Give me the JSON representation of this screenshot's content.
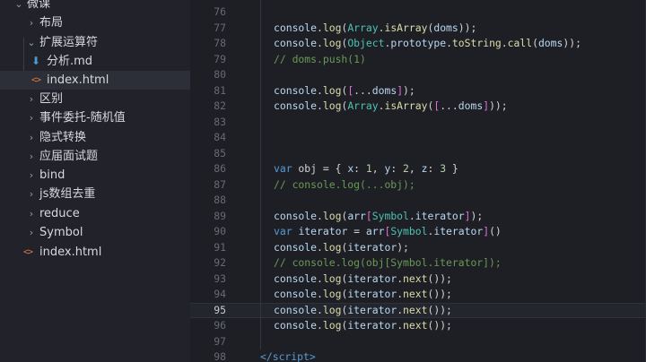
{
  "explorer": {
    "items": [
      {
        "label": "微课",
        "chevron": "⌄",
        "icon": "",
        "active": false
      },
      {
        "label": "布局",
        "chevron": "›",
        "icon": "",
        "active": false
      },
      {
        "label": "扩展运算符",
        "chevron": "⌄",
        "icon": "",
        "active": false
      },
      {
        "label": "分析.md",
        "chevron": "",
        "icon": "markdown-icon",
        "active": false
      },
      {
        "label": "index.html",
        "chevron": "",
        "icon": "html-icon",
        "active": true
      },
      {
        "label": "区别",
        "chevron": "›",
        "icon": "",
        "active": false
      },
      {
        "label": "事件委托-随机值",
        "chevron": "›",
        "icon": "",
        "active": false
      },
      {
        "label": "隐式转换",
        "chevron": "›",
        "icon": "",
        "active": false
      },
      {
        "label": "应届面试题",
        "chevron": "›",
        "icon": "",
        "active": false
      },
      {
        "label": "bind",
        "chevron": "›",
        "icon": "",
        "active": false
      },
      {
        "label": "js数组去重",
        "chevron": "›",
        "icon": "",
        "active": false
      },
      {
        "label": "reduce",
        "chevron": "›",
        "icon": "",
        "active": false
      },
      {
        "label": "Symbol",
        "chevron": "›",
        "icon": "",
        "active": false
      },
      {
        "label": "index.html",
        "chevron": "",
        "icon": "html-icon",
        "active": false
      }
    ],
    "html_icon_glyph": "<>",
    "md_icon_glyph": "⬇"
  },
  "editor": {
    "current_line": "95",
    "lines": [
      {
        "num": "76",
        "tokens": []
      },
      {
        "num": "77",
        "tokens": [
          [
            "console",
            "id"
          ],
          [
            ".",
            "plain"
          ],
          [
            "log",
            "fn"
          ],
          [
            "(",
            "plain"
          ],
          [
            "Array",
            "type"
          ],
          [
            ".",
            "plain"
          ],
          [
            "isArray",
            "fn"
          ],
          [
            "(",
            "plain"
          ],
          [
            "doms",
            "id"
          ],
          [
            "));",
            "plain"
          ]
        ]
      },
      {
        "num": "78",
        "tokens": [
          [
            "console",
            "id"
          ],
          [
            ".",
            "plain"
          ],
          [
            "log",
            "fn"
          ],
          [
            "(",
            "plain"
          ],
          [
            "Object",
            "type"
          ],
          [
            ".",
            "plain"
          ],
          [
            "prototype",
            "id"
          ],
          [
            ".",
            "plain"
          ],
          [
            "toString",
            "fn"
          ],
          [
            ".",
            "plain"
          ],
          [
            "call",
            "fn"
          ],
          [
            "(",
            "plain"
          ],
          [
            "doms",
            "id"
          ],
          [
            "));",
            "plain"
          ]
        ]
      },
      {
        "num": "79",
        "tokens": [
          [
            "// doms.push(1)",
            "cmt"
          ]
        ]
      },
      {
        "num": "80",
        "tokens": []
      },
      {
        "num": "81",
        "tokens": [
          [
            "console",
            "id"
          ],
          [
            ".",
            "plain"
          ],
          [
            "log",
            "fn"
          ],
          [
            "(",
            "plain"
          ],
          [
            "[",
            "brk"
          ],
          [
            "...",
            "plain"
          ],
          [
            "doms",
            "id"
          ],
          [
            "]",
            "brk"
          ],
          [
            ");",
            "plain"
          ]
        ]
      },
      {
        "num": "82",
        "tokens": [
          [
            "console",
            "id"
          ],
          [
            ".",
            "plain"
          ],
          [
            "log",
            "fn"
          ],
          [
            "(",
            "plain"
          ],
          [
            "Array",
            "type"
          ],
          [
            ".",
            "plain"
          ],
          [
            "isArray",
            "fn"
          ],
          [
            "(",
            "plain"
          ],
          [
            "[",
            "brk"
          ],
          [
            "...",
            "plain"
          ],
          [
            "doms",
            "id"
          ],
          [
            "]",
            "brk"
          ],
          [
            "));",
            "plain"
          ]
        ]
      },
      {
        "num": "83",
        "tokens": []
      },
      {
        "num": "84",
        "tokens": []
      },
      {
        "num": "85",
        "tokens": []
      },
      {
        "num": "86",
        "tokens": [
          [
            "var",
            "kw"
          ],
          [
            " obj = { ",
            "plain"
          ],
          [
            "x",
            "id"
          ],
          [
            ": ",
            "plain"
          ],
          [
            "1",
            "num"
          ],
          [
            ", ",
            "plain"
          ],
          [
            "y",
            "id"
          ],
          [
            ": ",
            "plain"
          ],
          [
            "2",
            "num"
          ],
          [
            ", ",
            "plain"
          ],
          [
            "z",
            "id"
          ],
          [
            ": ",
            "plain"
          ],
          [
            "3",
            "num"
          ],
          [
            " }",
            "plain"
          ]
        ]
      },
      {
        "num": "87",
        "tokens": [
          [
            "// console.log(...obj);",
            "cmt"
          ]
        ]
      },
      {
        "num": "88",
        "tokens": []
      },
      {
        "num": "89",
        "tokens": [
          [
            "console",
            "id"
          ],
          [
            ".",
            "plain"
          ],
          [
            "log",
            "fn"
          ],
          [
            "(",
            "plain"
          ],
          [
            "arr",
            "id"
          ],
          [
            "[",
            "brk"
          ],
          [
            "Symbol",
            "type"
          ],
          [
            ".",
            "plain"
          ],
          [
            "iterator",
            "id"
          ],
          [
            "]",
            "brk"
          ],
          [
            ");",
            "plain"
          ]
        ]
      },
      {
        "num": "90",
        "tokens": [
          [
            "var",
            "kw"
          ],
          [
            " ",
            "plain"
          ],
          [
            "iterator",
            "id"
          ],
          [
            " = ",
            "plain"
          ],
          [
            "arr",
            "id"
          ],
          [
            "[",
            "brk"
          ],
          [
            "Symbol",
            "type"
          ],
          [
            ".",
            "plain"
          ],
          [
            "iterator",
            "id"
          ],
          [
            "]",
            "brk"
          ],
          [
            "()",
            "plain"
          ]
        ]
      },
      {
        "num": "91",
        "tokens": [
          [
            "console",
            "id"
          ],
          [
            ".",
            "plain"
          ],
          [
            "log",
            "fn"
          ],
          [
            "(",
            "plain"
          ],
          [
            "iterator",
            "id"
          ],
          [
            ");",
            "plain"
          ]
        ]
      },
      {
        "num": "92",
        "tokens": [
          [
            "// console.log(obj[Symbol.iterator]);",
            "cmt"
          ]
        ]
      },
      {
        "num": "93",
        "tokens": [
          [
            "console",
            "id"
          ],
          [
            ".",
            "plain"
          ],
          [
            "log",
            "fn"
          ],
          [
            "(",
            "plain"
          ],
          [
            "iterator",
            "id"
          ],
          [
            ".",
            "plain"
          ],
          [
            "next",
            "fn"
          ],
          [
            "());",
            "plain"
          ]
        ]
      },
      {
        "num": "94",
        "tokens": [
          [
            "console",
            "id"
          ],
          [
            ".",
            "plain"
          ],
          [
            "log",
            "fn"
          ],
          [
            "(",
            "plain"
          ],
          [
            "iterator",
            "id"
          ],
          [
            ".",
            "plain"
          ],
          [
            "next",
            "fn"
          ],
          [
            "());",
            "plain"
          ]
        ]
      },
      {
        "num": "95",
        "tokens": [
          [
            "console",
            "id"
          ],
          [
            ".",
            "plain"
          ],
          [
            "log",
            "fn"
          ],
          [
            "(",
            "plain"
          ],
          [
            "iterator",
            "id"
          ],
          [
            ".",
            "plain"
          ],
          [
            "next",
            "fn"
          ],
          [
            "());",
            "plain"
          ]
        ]
      },
      {
        "num": "96",
        "tokens": [
          [
            "console",
            "id"
          ],
          [
            ".",
            "plain"
          ],
          [
            "log",
            "fn"
          ],
          [
            "(",
            "plain"
          ],
          [
            "iterator",
            "id"
          ],
          [
            ".",
            "plain"
          ],
          [
            "next",
            "fn"
          ],
          [
            "());",
            "plain"
          ]
        ]
      },
      {
        "num": "97",
        "tokens": []
      },
      {
        "num": "98",
        "tokens": [
          [
            "</",
            "tag"
          ],
          [
            "script",
            "tag"
          ],
          [
            ">",
            "tag"
          ]
        ]
      }
    ]
  },
  "mouse_cursor_glyph": "I"
}
